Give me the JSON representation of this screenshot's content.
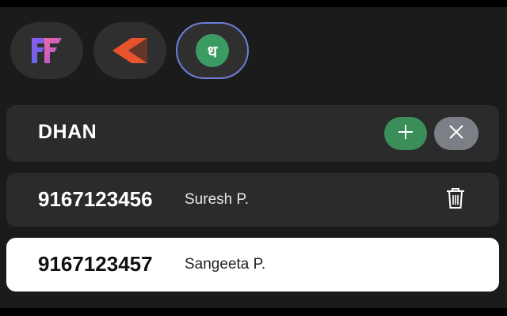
{
  "brokers": [
    {
      "icon": "fyers-logo-icon",
      "selected": false
    },
    {
      "icon": "kotak-logo-icon",
      "selected": false
    },
    {
      "icon": "dhan-logo-icon",
      "glyph": "ध",
      "selected": true
    }
  ],
  "header": {
    "title": "DHAN",
    "add_icon": "plus-icon",
    "close_icon": "close-icon"
  },
  "accounts": [
    {
      "number": "9167123456",
      "name": "Suresh P.",
      "selected": false,
      "action_icon": "trash-icon"
    },
    {
      "number": "9167123457",
      "name": "Sangeeta P.",
      "selected": true
    }
  ],
  "colors": {
    "background": "#1b1b1b",
    "card": "#2b2b2b",
    "selected_row": "#ffffff",
    "add_button": "#3a8e58",
    "close_button": "#7c7f86",
    "selected_tab_border": "#6e7fd9",
    "dhan_brand": "#3c9a63",
    "kotak_brand": "#e8522d"
  }
}
